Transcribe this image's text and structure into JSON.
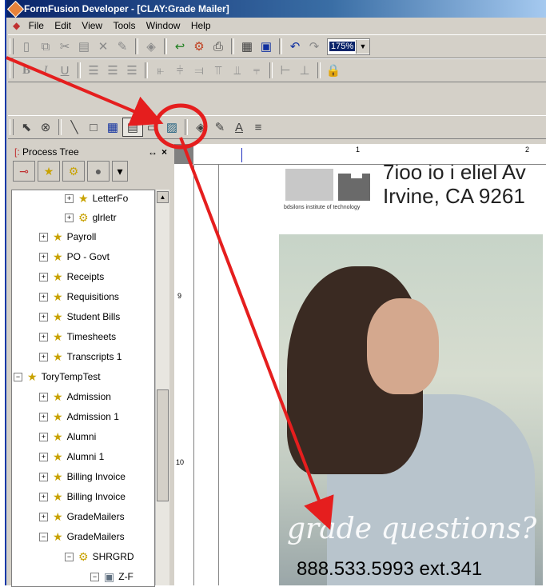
{
  "window": {
    "title": "FormFusion Developer - [CLAY:Grade Mailer]"
  },
  "menu": [
    "File",
    "Edit",
    "View",
    "Tools",
    "Window",
    "Help"
  ],
  "toolbar": {
    "zoom": "175%"
  },
  "formatting": {
    "bold": "B",
    "italic": "I",
    "underline": "U"
  },
  "draw_tools": {
    "text_underline": "A"
  },
  "process_tree": {
    "title": "Process Tree",
    "items": [
      {
        "label": "LetterFo",
        "icon": "folder-icon"
      },
      {
        "label": "glrletr",
        "icon": "gear-icon"
      },
      {
        "label": "Payroll",
        "icon": "folder-icon"
      },
      {
        "label": "PO - Govt",
        "icon": "folder-icon"
      },
      {
        "label": "Receipts",
        "icon": "folder-icon"
      },
      {
        "label": "Requisitions",
        "icon": "folder-icon"
      },
      {
        "label": "Student Bills",
        "icon": "folder-icon"
      },
      {
        "label": "Timesheets",
        "icon": "folder-icon"
      },
      {
        "label": "Transcripts 1",
        "icon": "folder-icon"
      },
      {
        "label": "ToryTempTest",
        "icon": "folder-icon"
      },
      {
        "label": "Admission",
        "icon": "folder-icon"
      },
      {
        "label": "Admission 1",
        "icon": "folder-icon"
      },
      {
        "label": "Alumni",
        "icon": "folder-icon"
      },
      {
        "label": "Alumni 1",
        "icon": "folder-icon"
      },
      {
        "label": "Billing Invoice",
        "icon": "folder-icon"
      },
      {
        "label": "Billing Invoice",
        "icon": "folder-icon"
      },
      {
        "label": "GradeMailers",
        "icon": "folder-icon"
      },
      {
        "label": "GradeMailers",
        "icon": "folder-icon"
      },
      {
        "label": "SHRGRD",
        "icon": "gear-icon"
      },
      {
        "label": "Z-F",
        "icon": "document-icon"
      }
    ]
  },
  "ruler": {
    "h_labels": [
      "1",
      "2"
    ],
    "v_labels": [
      "9",
      "10"
    ]
  },
  "document": {
    "address_line1": "7ioo io i eliel Av",
    "address_line2": "Irvine, CA 9261",
    "logo_caption": "bdsilons institute of technology",
    "grade_questions": "grade questions?",
    "phone": "888.533.5993 ext.341"
  }
}
